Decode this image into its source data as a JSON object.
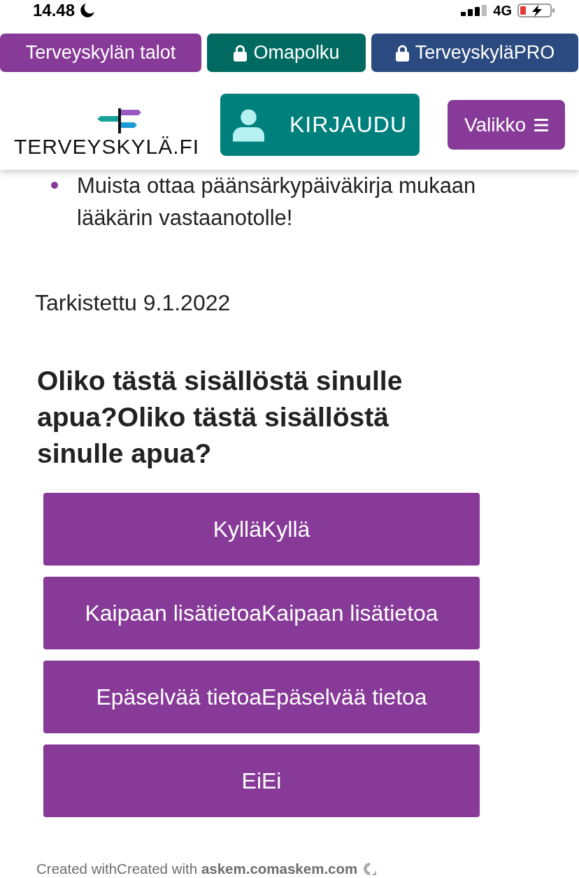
{
  "status_bar": {
    "time": "14.48",
    "network": "4G"
  },
  "top_links": [
    {
      "label": "Terveyskylän talot",
      "locked": false,
      "color": "#873a97"
    },
    {
      "label": "Omapolku",
      "locked": true,
      "color": "#006a61"
    },
    {
      "label": "TerveyskyläPRO",
      "locked": true,
      "color": "#2b4a80"
    }
  ],
  "header": {
    "logo": "TERVEYSKYLÄ.FI",
    "login_button": "KIRJAUDU",
    "menu_button": "Valikko"
  },
  "content": {
    "list_items": [
      "Muista ottaa päänsärkypäiväkirja mukaan lääkärin vastaanotolle!"
    ],
    "reviewed": "Tarkistettu 9.1.2022"
  },
  "feedback": {
    "question": "Oliko tästä sisällöstä sinulle apua?Oliko tästä sisällöstä sinulle apua?",
    "options": [
      "KylläKyllä",
      "Kaipaan lisätietoaKaipaan lisätietoa",
      "Epäselvää tietoaEpäselvää tietoa",
      "EiEi"
    ],
    "footer": "Created withCreated with **askem.comaskem.com**"
  }
}
